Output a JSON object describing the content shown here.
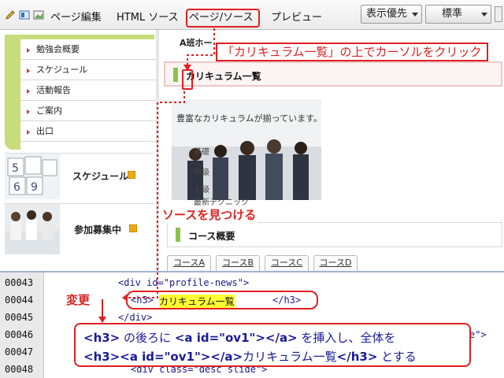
{
  "toolbar": {
    "modes": [
      "ページ編集",
      "HTML ソース",
      "ページ/ソース",
      "プレビュー"
    ],
    "view_priority": "表示優先",
    "zoom": "標準",
    "icons": [
      "pencil-icon",
      "layout-icon"
    ]
  },
  "preview": {
    "nav_items": [
      "勉強会概要",
      "スケジュール",
      "活動報告",
      "ご案内",
      "出口"
    ],
    "banners": [
      {
        "label": "スケジュール"
      },
      {
        "label": "参加募集中"
      }
    ],
    "crumb": "A班ホー",
    "h3_heading": "カリキュラム一覧",
    "course_intro": "豊富なカリキュラムが揃っています。",
    "photo_labels": [
      "基礎",
      "中級",
      "上級",
      "最新テクニック"
    ],
    "overview_heading": "コース概要",
    "course_tabs": [
      "コースA",
      "コースB",
      "コースC",
      "コースD"
    ]
  },
  "source": {
    "lines": [
      {
        "no": "00043",
        "code": "<div id=\"profile-news\">"
      },
      {
        "no": "00044",
        "code": "<h3>カリキュラム一覧</h3>"
      },
      {
        "no": "00045",
        "code": "</div>"
      },
      {
        "no": "00046",
        "code": ""
      },
      {
        "no": "00047",
        "code": ""
      },
      {
        "no": "00048",
        "code": "<div class=\"desc slide\">"
      }
    ],
    "partial_tail": "e\">"
  },
  "annotations": {
    "click_instruction": "「カリキュラム一覧」の上でカーソルをクリック",
    "find_source": "ソースを見つける",
    "change": "変更",
    "bubble_line1_a": "<h3>",
    "bubble_line1_b": " の後ろに ",
    "bubble_line1_c": "<a id=\"ov1\"></a>",
    "bubble_line1_d": " を挿入し、全体を",
    "bubble_line2_a": "<h3><a id=\"ov1\"></a>",
    "bubble_line2_b": "カリキュラム一覧",
    "bubble_line2_c": "</h3>",
    "bubble_line2_d": " とする"
  },
  "colors": {
    "annotation_red": "#e02020",
    "highlight_yellow": "#ffff33",
    "accent_green": "#8bc34a",
    "code_blue": "#1a1a8c"
  }
}
